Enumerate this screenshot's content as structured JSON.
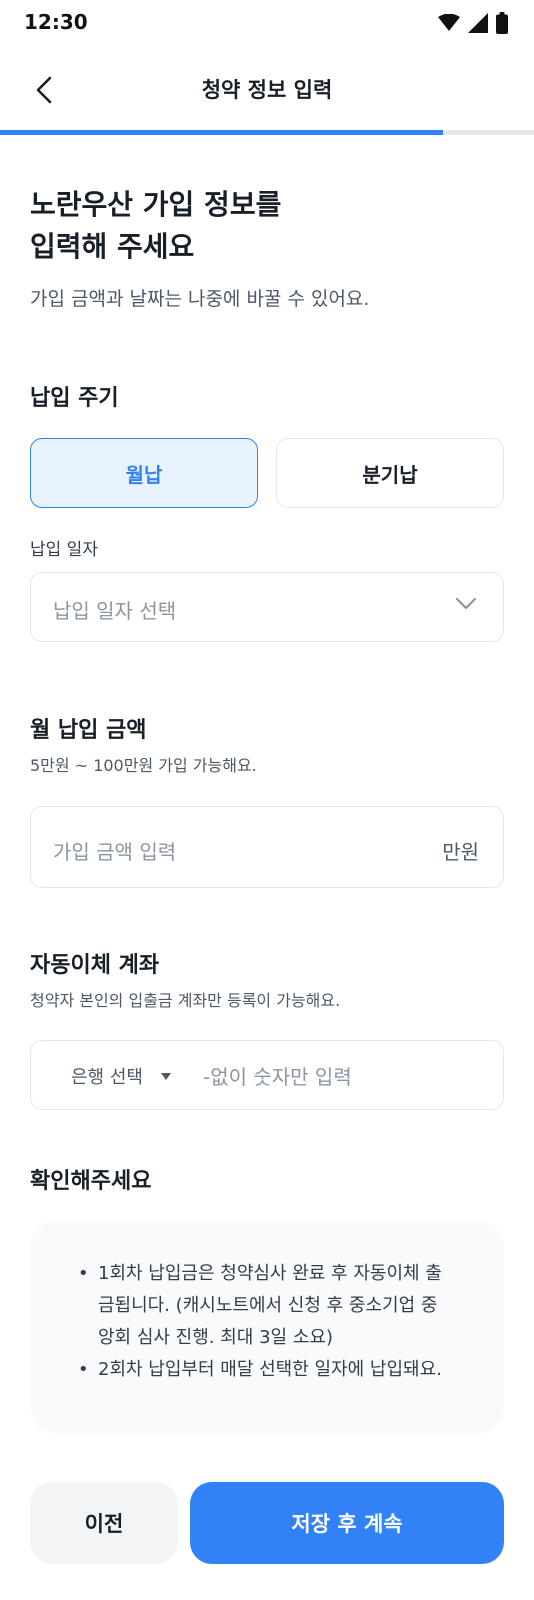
{
  "status_bar": {
    "time": "12:30",
    "icons": [
      "wifi-icon",
      "cell-signal-icon",
      "battery-icon"
    ]
  },
  "app_bar": {
    "title": "청약 정보 입력",
    "back_icon": "chevron-left-icon"
  },
  "progress": {
    "value": 0.83,
    "color": "#3182f6"
  },
  "headline": {
    "line1": "노란우산 가입 정보를",
    "line2": "입력해 주세요",
    "subtitle": "가입 금액과 날짜는 나중에 바꿀 수 있어요."
  },
  "payment_cycle": {
    "title": "납입 주기",
    "options": [
      {
        "label": "월납",
        "selected": true
      },
      {
        "label": "분기납",
        "selected": false
      }
    ]
  },
  "payment_date": {
    "label": "납입 일자",
    "placeholder": "납입 일자 선택",
    "icon": "chevron-down-icon"
  },
  "monthly_amount": {
    "title": "월 납입 금액",
    "help": "5만원 ~ 100만원 가입 가능해요.",
    "placeholder": "가입 금액 입력",
    "unit": "만원"
  },
  "auto_transfer": {
    "title": "자동이체 계좌",
    "help": "청약자 본인의 입출금 계좌만 등록이 가능해요.",
    "bank_select": "은행 선택",
    "account_placeholder": "-없이 숫자만 입력"
  },
  "notice": {
    "title": "확인해주세요",
    "items": [
      {
        "lines": [
          "1회차 납입금은 청약심사 완료 후 자동이체 출",
          "금됩니다. (캐시노트에서 신청 후 중소기업 중",
          "앙회 심사 진행. 최대 3일 소요)"
        ]
      },
      {
        "lines": [
          "2회차 납입부터 매달 선택한 일자에 납입돼요."
        ]
      }
    ]
  },
  "footer": {
    "prev_label": "이전",
    "next_label": "저장 후 계속"
  },
  "colors": {
    "accent": "#3182f6",
    "accent_bg": "#e8f3ff",
    "text": "#191f28",
    "muted": "#8b95a1"
  }
}
